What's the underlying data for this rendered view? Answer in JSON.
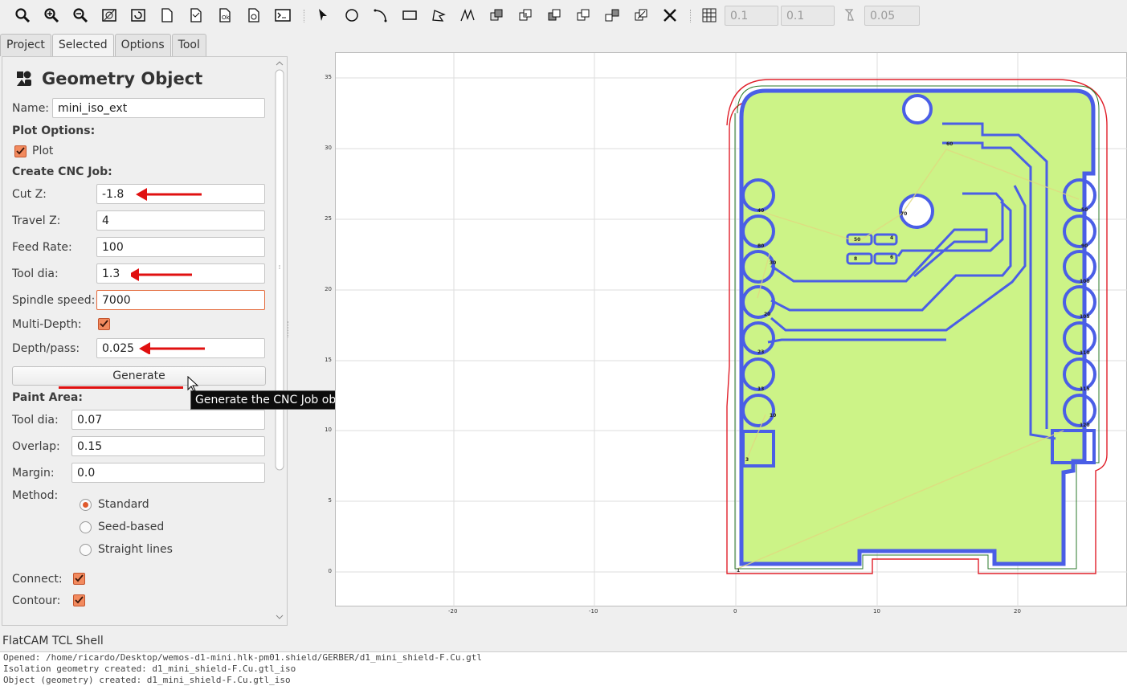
{
  "toolbar": {
    "icons": [
      "zoom-fit-icon",
      "zoom-in-icon",
      "zoom-out-icon",
      "clear-plot-icon",
      "replot-icon",
      "new-geometry-icon",
      "new-path-icon",
      "new-text-icon",
      "delete-icon",
      "shell-icon",
      "select-icon",
      "circle-icon",
      "arc-icon",
      "rectangle-icon",
      "polygon-icon",
      "path-icon",
      "union-icon",
      "intersection-icon",
      "subtract-icon",
      "cut-icon",
      "copy-icon",
      "move-icon",
      "delete-shape-icon",
      "grid-icon",
      "snap-icon"
    ],
    "grid_x": "0.1",
    "grid_y": "0.1",
    "snap_max": "0.05"
  },
  "tabs": [
    "Project",
    "Selected",
    "Options",
    "Tool"
  ],
  "active_tab": "Selected",
  "panel": {
    "title": "Geometry Object",
    "name_label": "Name:",
    "name_value": "mini_iso_ext",
    "plot_options": "Plot Options:",
    "plot_label": "Plot",
    "create_cnc": "Create CNC Job:",
    "cut_z_label": "Cut Z:",
    "cut_z": "-1.8",
    "travel_z_label": "Travel Z:",
    "travel_z": "4",
    "feed_label": "Feed Rate:",
    "feed": "100",
    "tooldia_label": "Tool dia:",
    "tooldia": "1.3",
    "spindle_label": "Spindle speed:",
    "spindle": "7000",
    "multidepth_label": "Multi-Depth:",
    "depth_label": "Depth/pass:",
    "depth": "0.025",
    "generate": "Generate",
    "paint_area": "Paint Area:",
    "paint_tooldia_label": "Tool dia:",
    "paint_tooldia": "0.07",
    "overlap_label": "Overlap:",
    "overlap": "0.15",
    "margin_label": "Margin:",
    "margin": "0.0",
    "method_label": "Method:",
    "methods": [
      "Standard",
      "Seed-based",
      "Straight lines"
    ],
    "connect_label": "Connect:",
    "contour_label": "Contour:"
  },
  "tooltip": "Generate the CNC Job object.",
  "plot": {
    "y_ticks": [
      "35",
      "30",
      "25",
      "20",
      "15",
      "10",
      "5",
      "0"
    ],
    "x_ticks": [
      "-20",
      "-10",
      "0",
      "10",
      "20"
    ],
    "colors": {
      "fill": "#ccf387",
      "iso": "#4a5ee6",
      "cutout": "#e0202a",
      "outline": "#2b7a2b"
    },
    "left_pads": [
      "40",
      "80",
      "30",
      "20",
      "23",
      "10",
      "13"
    ],
    "right_pads": [
      "50",
      "90",
      "100",
      "105",
      "110",
      "115",
      "120"
    ],
    "labels": {
      "a": "60",
      "b": "70",
      "c": "50",
      "d": "4",
      "e": "8",
      "f": "6",
      "g": "3",
      "h": "1"
    }
  },
  "shell": {
    "title": "FlatCAM TCL Shell",
    "lines": [
      "Opened: /home/ricardo/Desktop/wemos-d1-mini.hlk-pm01.shield/GERBER/d1_mini_shield-F.Cu.gtl",
      "Isolation geometry created: d1_mini_shield-F.Cu.gtl_iso",
      "Object (geometry) created: d1_mini_shield-F.Cu.gtl_iso"
    ]
  }
}
